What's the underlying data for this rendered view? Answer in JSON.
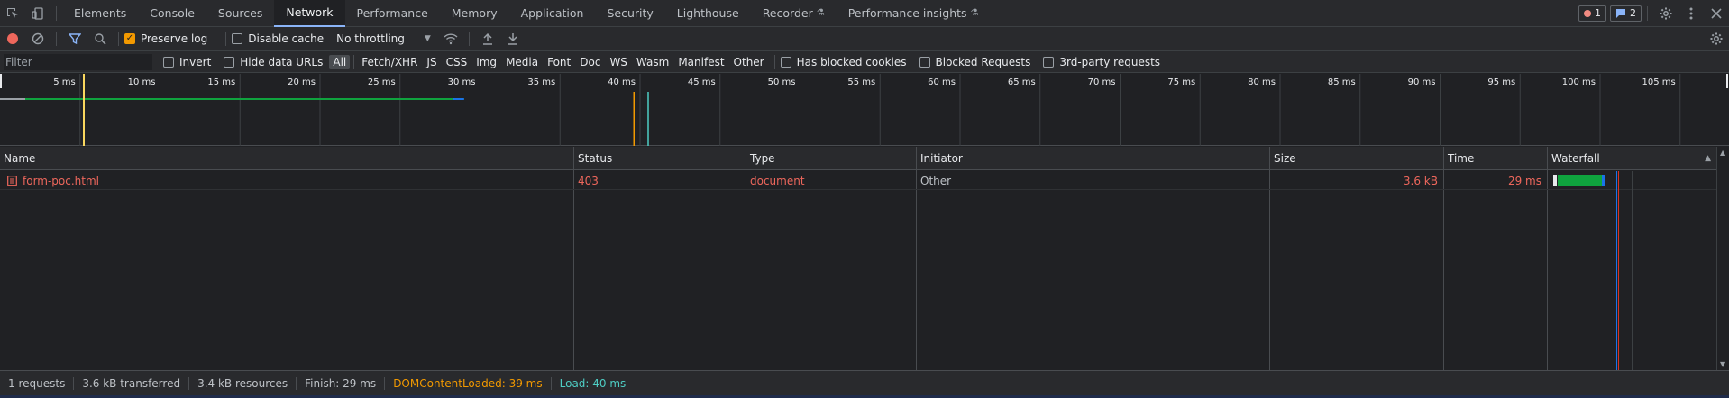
{
  "tabs": [
    {
      "label": "Elements"
    },
    {
      "label": "Console"
    },
    {
      "label": "Sources"
    },
    {
      "label": "Network",
      "active": true
    },
    {
      "label": "Performance"
    },
    {
      "label": "Memory"
    },
    {
      "label": "Application"
    },
    {
      "label": "Security"
    },
    {
      "label": "Lighthouse"
    },
    {
      "label": "Recorder",
      "experimental": true
    },
    {
      "label": "Performance insights",
      "experimental": true
    }
  ],
  "badges": {
    "errors": "1",
    "messages": "2"
  },
  "toolbar": {
    "preserve_log": "Preserve log",
    "preserve_log_checked": true,
    "disable_cache": "Disable cache",
    "disable_cache_checked": false,
    "throttling": "No throttling"
  },
  "filterbar": {
    "placeholder": "Filter",
    "invert": "Invert",
    "hide_data_urls": "Hide data URLs",
    "types": [
      "All",
      "Fetch/XHR",
      "JS",
      "CSS",
      "Img",
      "Media",
      "Font",
      "Doc",
      "WS",
      "Wasm",
      "Manifest",
      "Other"
    ],
    "active_type": "All",
    "has_blocked_cookies": "Has blocked cookies",
    "blocked_requests": "Blocked Requests",
    "third_party": "3rd-party requests"
  },
  "overview": {
    "ticks": [
      "5 ms",
      "10 ms",
      "15 ms",
      "20 ms",
      "25 ms",
      "30 ms",
      "35 ms",
      "40 ms",
      "45 ms",
      "50 ms",
      "55 ms",
      "60 ms",
      "65 ms",
      "70 ms",
      "75 ms",
      "80 ms",
      "85 ms",
      "90 ms",
      "95 ms",
      "100 ms",
      "105 ms"
    ],
    "dom_content_loaded_ms": 39,
    "load_ms": 40,
    "finish_ms": 29
  },
  "table": {
    "columns": [
      "Name",
      "Status",
      "Type",
      "Initiator",
      "Size",
      "Time",
      "Waterfall"
    ],
    "rows": [
      {
        "name": "form-poc.html",
        "status": "403",
        "type": "document",
        "initiator": "Other",
        "size": "3.6 kB",
        "time": "29 ms"
      }
    ]
  },
  "statusbar": {
    "requests": "1 requests",
    "transferred": "3.6 kB transferred",
    "resources": "3.4 kB resources",
    "finish": "Finish: 29 ms",
    "dom_content_loaded": "DOMContentLoaded: 39 ms",
    "load": "Load: 40 ms"
  },
  "colors": {
    "accent": "#8ab4f8",
    "error": "#ee675c",
    "dom_content_loaded": "#f29900",
    "load": "#4ecdc4",
    "waterfall_bar": "#0fa33e"
  }
}
